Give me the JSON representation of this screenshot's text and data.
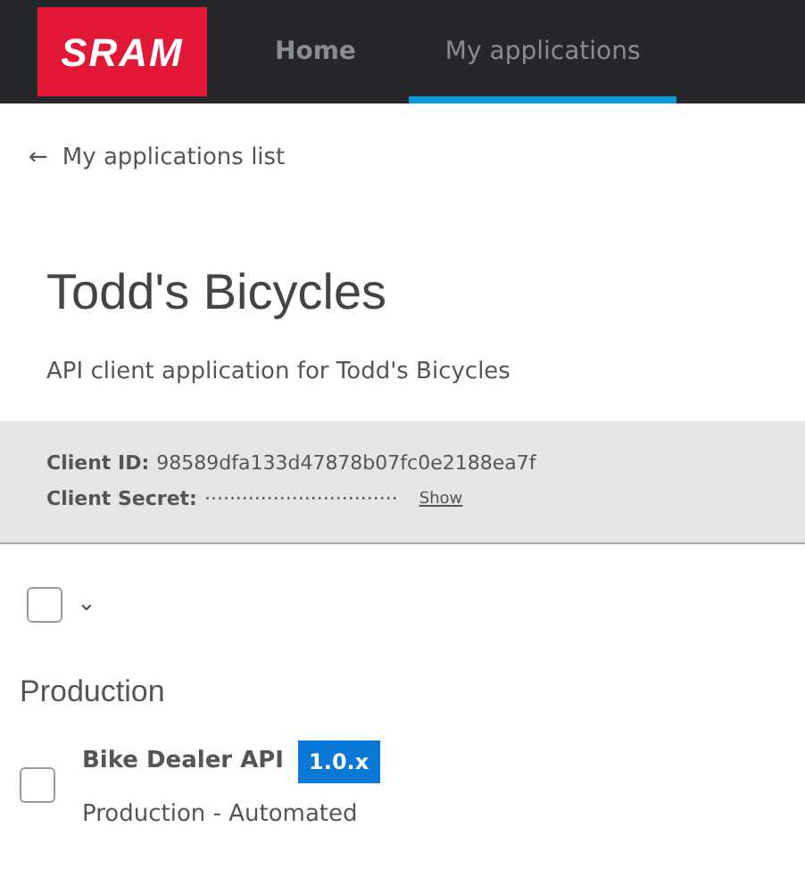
{
  "navbar": {
    "logo": "SRAM",
    "tabs": [
      {
        "label": "Home",
        "selected": false
      },
      {
        "label": "My applications",
        "selected": true
      }
    ]
  },
  "back_link": {
    "icon": "←",
    "label": "My applications list"
  },
  "title": "Todd's Bicycles",
  "description": "API client application for Todd's Bicycles",
  "credentials": [
    {
      "label": "Client ID:",
      "value": "98589dfa133d47878b07fc0e2188ea7f"
    },
    {
      "label": "Client Secret:",
      "value": "·······························",
      "action": "Show"
    }
  ],
  "select_all": {
    "checked": false,
    "caret": "⌄"
  },
  "sections": [
    {
      "heading": "Production",
      "apis": [
        {
          "name": "Bike Dealer API",
          "version": "1.0.x",
          "subtitle": "Production - Automated",
          "checked": false
        }
      ]
    }
  ]
}
